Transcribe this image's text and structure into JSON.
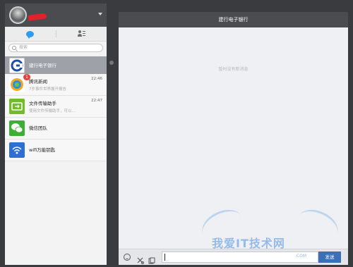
{
  "sidebar": {
    "search_placeholder": "搜索",
    "items": [
      {
        "name": "建行电子银行",
        "preview": "",
        "time": "",
        "badge": "",
        "icon": "ccb-logo-icon",
        "active": true
      },
      {
        "name": "腾讯新闻",
        "preview": "7岁事件世界展开报告",
        "time": "22:46",
        "badge": "1",
        "icon": "news-icon",
        "active": false
      },
      {
        "name": "文件传输助手",
        "preview": "使用文件传输助手，可以...",
        "time": "22:47",
        "badge": "",
        "icon": "file-transfer-icon",
        "active": false
      },
      {
        "name": "微信团队",
        "preview": "",
        "time": "",
        "badge": "",
        "icon": "wechat-team-icon",
        "active": false
      },
      {
        "name": "wifi万能钥匙",
        "preview": "",
        "time": "",
        "badge": "",
        "icon": "wifi-key-icon",
        "active": false
      }
    ]
  },
  "chat": {
    "title": "建行电子银行",
    "empty_text": "暂时没有新消息",
    "send_label": "发送"
  },
  "watermark": {
    "text": "我爱IT技术网",
    "url": ".COM"
  },
  "colors": {
    "header": "#4a4c50",
    "active_item": "#9ea2a8",
    "send_button": "#3c6fb7",
    "badge": "#e8403a"
  }
}
